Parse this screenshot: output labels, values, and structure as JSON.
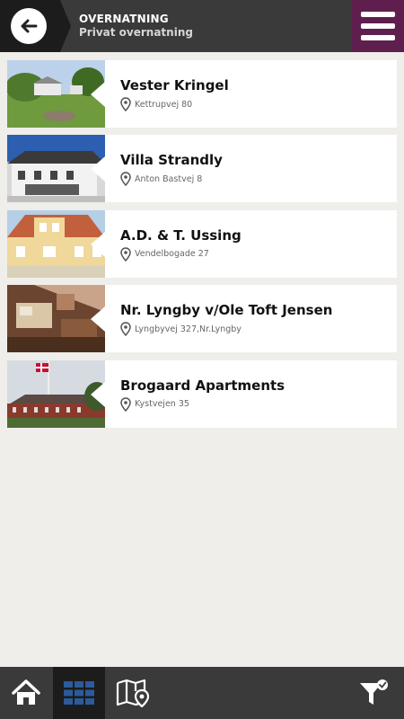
{
  "header": {
    "title": "OVERNATNING",
    "subtitle": "Privat overnatning",
    "back_icon": "arrow-left-icon",
    "menu_icon": "hamburger-menu-icon",
    "accent_color": "#5f1f4e"
  },
  "items": [
    {
      "name": "Vester Kringel",
      "address": "Kettrupvej 80"
    },
    {
      "name": "Villa Strandly",
      "address": "Anton Bastvej 8"
    },
    {
      "name": "A.D. & T. Ussing",
      "address": "Vendelbogade 27"
    },
    {
      "name": "Nr. Lyngby v/Ole Toft Jensen",
      "address": "Lyngbyvej 327,Nr.Lyngby"
    },
    {
      "name": "Brogaard Apartments",
      "address": "Kystvejen 35"
    }
  ],
  "footer": {
    "home_icon": "home-icon",
    "grid_icon": "grid-icon",
    "map_icon": "map-pin-icon",
    "filter_icon": "filter-check-icon"
  }
}
